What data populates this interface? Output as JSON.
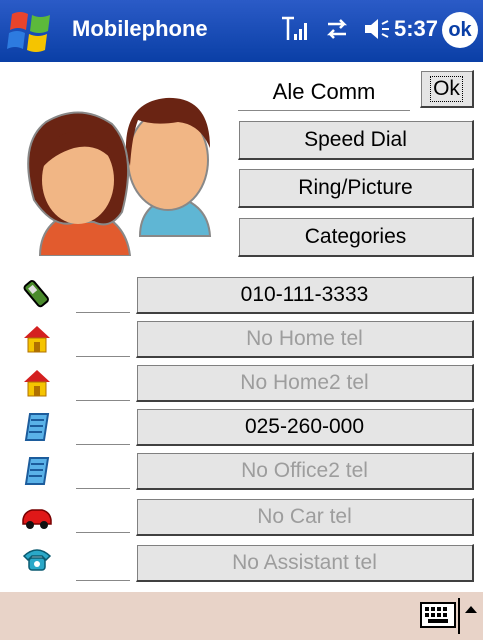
{
  "titlebar": {
    "title": "Mobilephone",
    "time": "5:37",
    "ok": "ok"
  },
  "contact": {
    "name": "Ale Comm",
    "ok_label": "Ok"
  },
  "actions": [
    {
      "label": "Speed Dial"
    },
    {
      "label": "Ring/Picture"
    },
    {
      "label": "Categories"
    }
  ],
  "phones": [
    {
      "icon": "mobile-phone-icon",
      "value": "010-111-3333",
      "enabled": true
    },
    {
      "icon": "home-icon",
      "value": "No Home tel",
      "enabled": false
    },
    {
      "icon": "home2-icon",
      "value": "No Home2 tel",
      "enabled": false
    },
    {
      "icon": "office-icon",
      "value": "025-260-000",
      "enabled": true
    },
    {
      "icon": "office2-icon",
      "value": "No Office2 tel",
      "enabled": false
    },
    {
      "icon": "car-icon",
      "value": "No Car tel",
      "enabled": false
    },
    {
      "icon": "assistant-phone-icon",
      "value": "No Assistant tel",
      "enabled": false
    }
  ],
  "colors": {
    "titlebar": "#0a3fa6",
    "bottombar": "#e8d3c8",
    "button": "#e5e5e5",
    "disabled_text": "#9d9d9d"
  }
}
